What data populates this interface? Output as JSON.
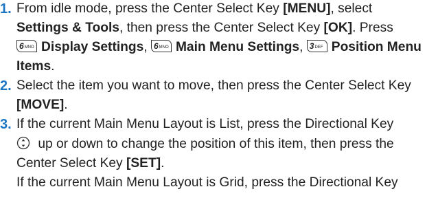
{
  "steps": [
    {
      "number": "1.",
      "t1": "From idle mode, press the Center Select Key ",
      "b1": "[MENU]",
      "t2": ", select",
      "b2": "Settings & Tools",
      "t3": ", then press the Center Select Key ",
      "b3": "[OK]",
      "t4": ". Press",
      "key1": {
        "digit": "6",
        "letters": "MNO"
      },
      "b4": "Display Settings",
      "sep1": ", ",
      "key2": {
        "digit": "6",
        "letters": "MNO"
      },
      "b5": "Main Menu Settings",
      "sep2": ", ",
      "key3": {
        "digit": "3",
        "letters": "DEF"
      },
      "b6": "Position Menu Items",
      "t5": "."
    },
    {
      "number": "2.",
      "t1": "Select the item you want to move, then press the Center Select Key",
      "b1": "[MOVE]",
      "t2": "."
    },
    {
      "number": "3.",
      "t1": "If the current Main Menu Layout is List, press the Directional Key",
      "t2": " up or down to change the position of this item, then press the",
      "t3": "Center Select Key ",
      "b1": "[SET]",
      "t4": ".",
      "p2": "If the current Main Menu Layout is Grid, press the Directional Key"
    }
  ],
  "icons": {
    "directional_key": "directional-key-up-down-icon"
  },
  "colors": {
    "step_number": "#1a75c4",
    "text": "#222222"
  }
}
